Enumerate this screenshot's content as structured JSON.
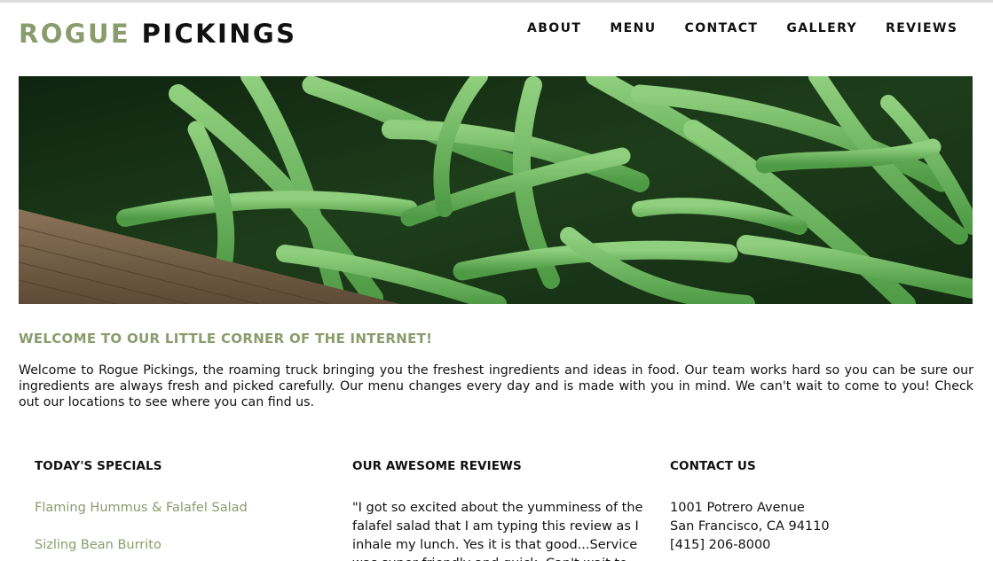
{
  "brand": {
    "part1": "ROGUE",
    "part2": "PICKINGS"
  },
  "nav": {
    "items": [
      {
        "label": "ABOUT"
      },
      {
        "label": "MENU"
      },
      {
        "label": "CONTACT"
      },
      {
        "label": "GALLERY"
      },
      {
        "label": "REVIEWS"
      }
    ]
  },
  "hero": {
    "alt": "Green beans in a wooden crate"
  },
  "welcome": {
    "title": "WELCOME TO OUR LITTLE CORNER OF THE INTERNET!",
    "text": "Welcome to Rogue Pickings, the roaming truck bringing you the freshest ingredients and ideas in food. Our team works hard so you can be sure our ingredients are always fresh and picked carefully. Our menu changes every day and is made with you in mind. We can't wait to come to you! Check out our locations to see where you can find us."
  },
  "specials": {
    "title": "TODAY'S SPECIALS",
    "items": [
      {
        "label": "Flaming Hummus & Falafel Salad"
      },
      {
        "label": "Sizling Bean Burrito"
      }
    ]
  },
  "reviews": {
    "title": "OUR AWESOME REVIEWS",
    "text": "\"I got so excited about the yumminess of the falafel salad that I am typing this review as I inhale my lunch. Yes it is that good...Service was super friendly and quick. Can't wait to"
  },
  "contact": {
    "title": "CONTACT US",
    "address1": "1001 Potrero Avenue",
    "address2": "San Francisco, CA 94110",
    "phone": "[415] 206-8000"
  },
  "colors": {
    "accent": "#8a9c6c",
    "text": "#111111"
  }
}
